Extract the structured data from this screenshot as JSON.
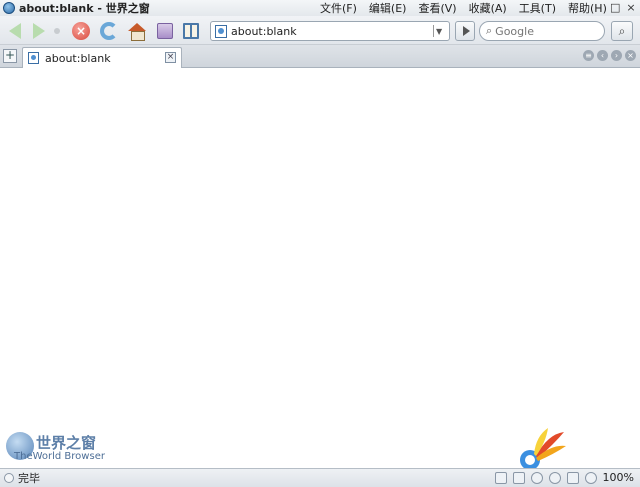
{
  "window": {
    "title": "about:blank - 世界之窗"
  },
  "menu": [
    "文件(F)",
    "编辑(E)",
    "查看(V)",
    "收藏(A)",
    "工具(T)",
    "帮助(H)"
  ],
  "window_controls": {
    "minimize": "–",
    "maximize": "□",
    "close": "×"
  },
  "toolbar": {
    "stop_glyph": "×"
  },
  "address": {
    "value": "about:blank"
  },
  "search": {
    "placeholder": "Google",
    "lens": "⌕",
    "button": "⌕"
  },
  "tabs": [
    {
      "label": "about:blank",
      "close_glyph": "×"
    }
  ],
  "new_tab": "+",
  "tab_controls": [
    "≡",
    "‹",
    "›",
    "×"
  ],
  "branding": {
    "name_cn": "世界之窗",
    "name_en": "TheWorld Browser"
  },
  "status": {
    "text": "完毕",
    "zoom": "100%"
  }
}
